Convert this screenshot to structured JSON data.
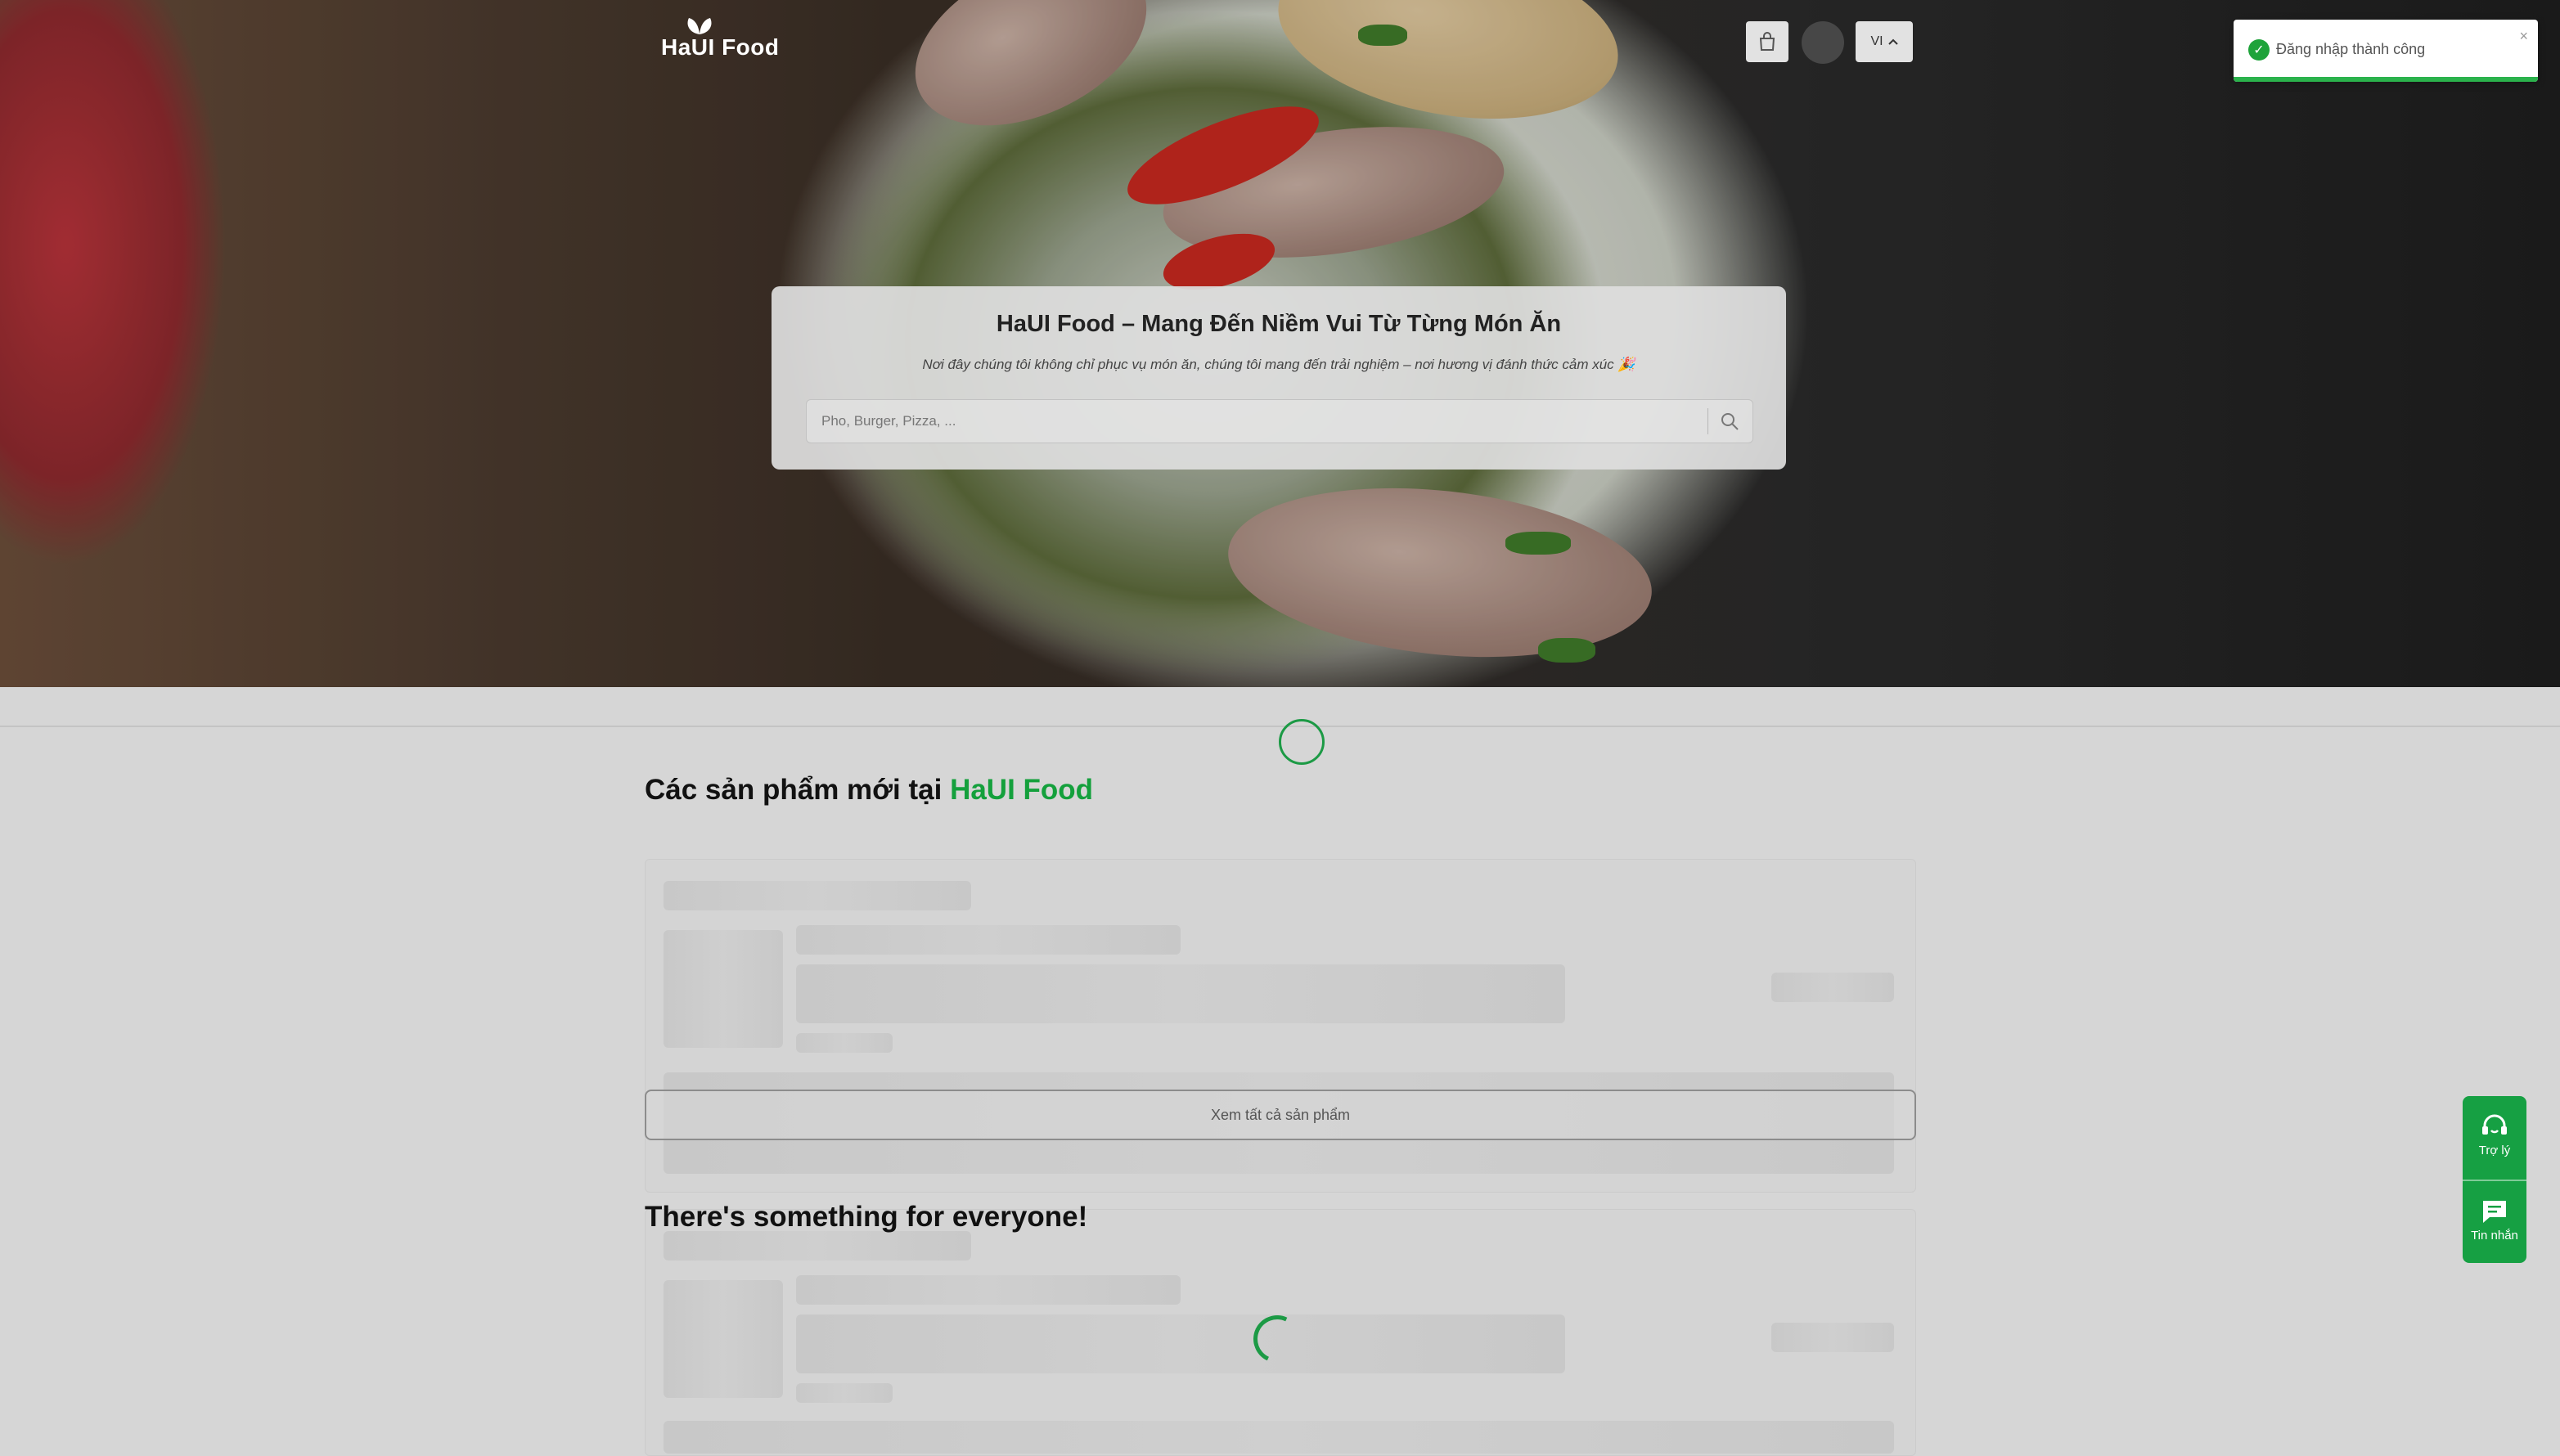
{
  "brand": {
    "logo_text": "HaUI Food",
    "accent": "#14a03c"
  },
  "header": {
    "lang_label": "VI"
  },
  "toast": {
    "message": "Đăng nhập thành công",
    "close_glyph": "×",
    "status_color": "#1ea33a"
  },
  "hero": {
    "title": "HaUI Food – Mang Đến Niềm Vui Từ Từng Món Ăn",
    "subtitle": "Nơi đây chúng tôi không chỉ phục vụ món ăn, chúng tôi mang đến trải nghiệm – nơi hương vị đánh thức cảm xúc 🎉",
    "search_placeholder": "Pho, Burger, Pizza, ..."
  },
  "sections": {
    "new_products": {
      "title_prefix": "Các sản phẩm mới tại ",
      "title_highlight": "HaUI Food",
      "view_all_label": "Xem tất cả sản phẩm"
    },
    "everyone": {
      "title": "There's something for everyone!"
    }
  },
  "fab": {
    "support_label": "Trợ lý",
    "messages_label": "Tin nhắn"
  },
  "icons": {
    "cart": "bag-icon",
    "search": "search-icon",
    "support": "headset-icon",
    "messages": "chat-icon",
    "toast": "check-circle-icon",
    "lang": "chevron-up-icon"
  }
}
